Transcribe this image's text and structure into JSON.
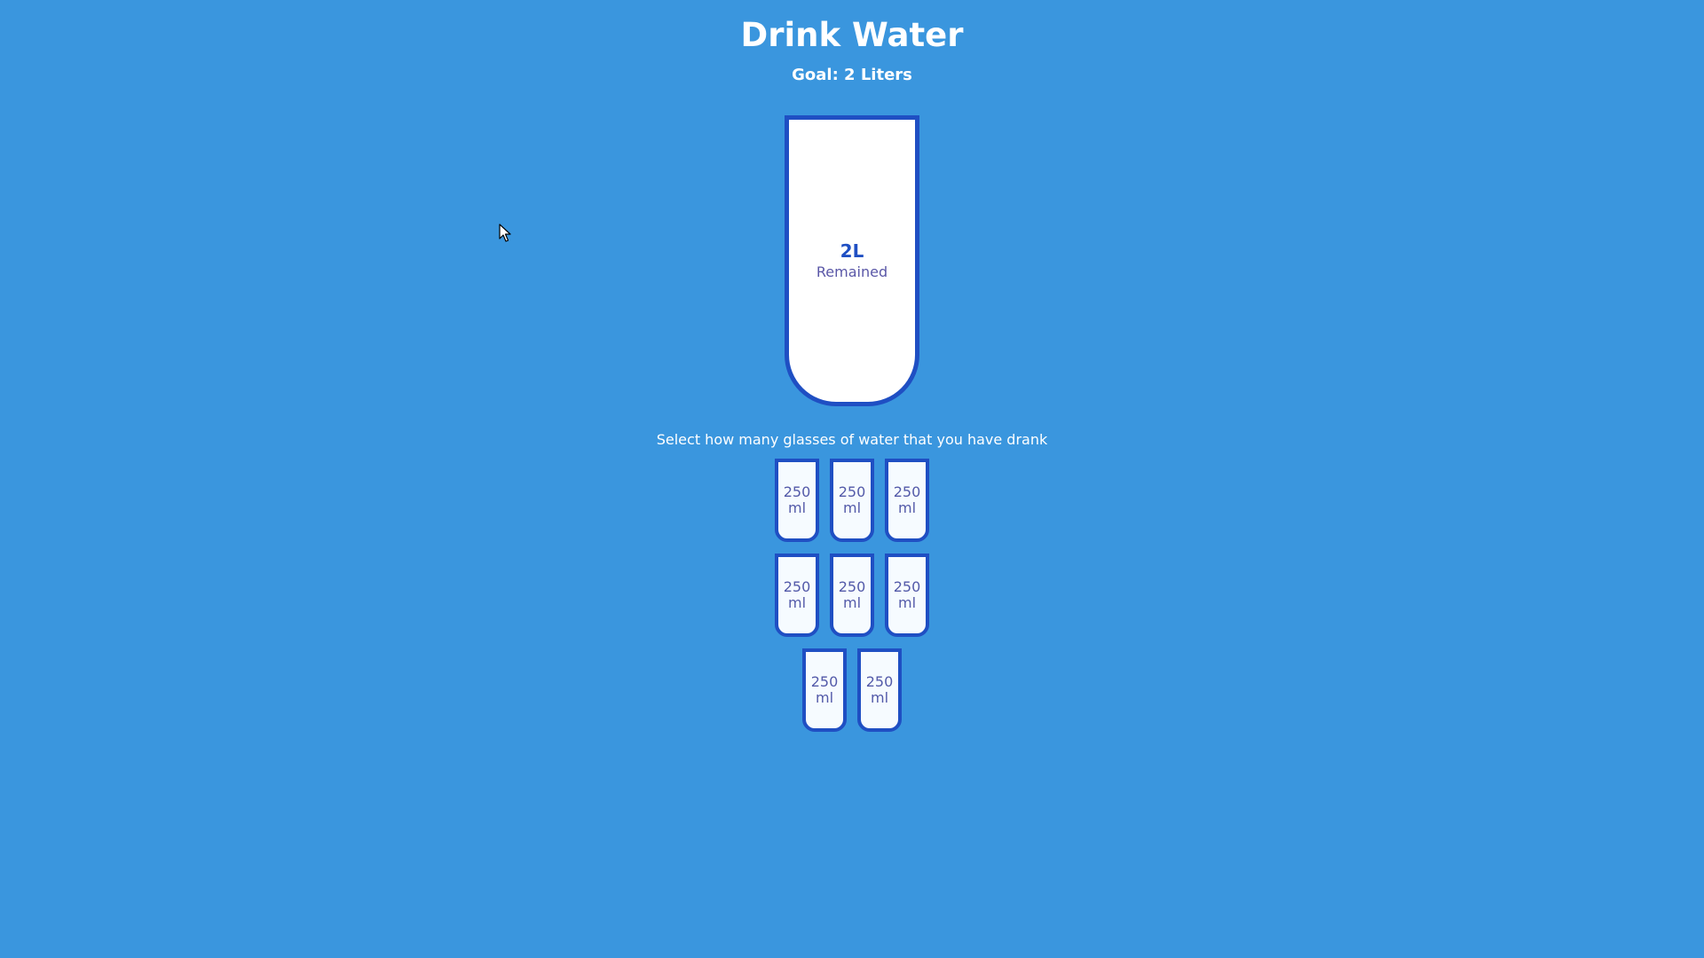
{
  "app": {
    "title": "Drink Water",
    "goal_text": "Goal: 2 Liters"
  },
  "big_cup": {
    "remaining_value": "2L",
    "remaining_label": "Remained",
    "fill_fraction": 0
  },
  "instruction": "Select how many glasses of water that you have drank",
  "cups": [
    {
      "amount": "250",
      "unit": "ml",
      "selected": false
    },
    {
      "amount": "250",
      "unit": "ml",
      "selected": false
    },
    {
      "amount": "250",
      "unit": "ml",
      "selected": false
    },
    {
      "amount": "250",
      "unit": "ml",
      "selected": false
    },
    {
      "amount": "250",
      "unit": "ml",
      "selected": false
    },
    {
      "amount": "250",
      "unit": "ml",
      "selected": false
    },
    {
      "amount": "250",
      "unit": "ml",
      "selected": false
    },
    {
      "amount": "250",
      "unit": "ml",
      "selected": false
    }
  ],
  "colors": {
    "background": "#3a96de",
    "cup_border": "#1f4fc3",
    "cup_text": "#535aa9",
    "water_fill": "#6ab3f8"
  },
  "icons": {
    "cursor": "mouse-pointer-icon"
  }
}
